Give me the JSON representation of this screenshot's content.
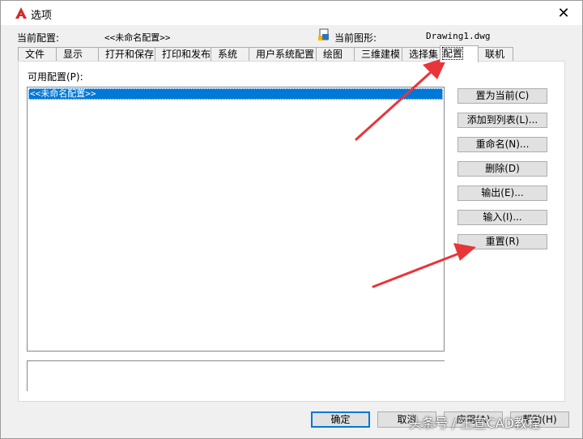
{
  "window": {
    "title": "选项",
    "close_label": "✕"
  },
  "info": {
    "current_profile_label": "当前配置:",
    "current_profile_value": "<<未命名配置>>",
    "current_drawing_label": "当前图形:",
    "current_drawing_value": "Drawing1.dwg"
  },
  "tabs": [
    {
      "label": "文件"
    },
    {
      "label": "显示"
    },
    {
      "label": "打开和保存"
    },
    {
      "label": "打印和发布"
    },
    {
      "label": "系统"
    },
    {
      "label": "用户系统配置"
    },
    {
      "label": "绘图"
    },
    {
      "label": "三维建模"
    },
    {
      "label": "选择集"
    },
    {
      "label": "配置",
      "active": true
    },
    {
      "label": "联机"
    }
  ],
  "profiles": {
    "label": "可用配置(P):",
    "items": [
      "<<未命名配置>>"
    ],
    "selected_index": 0
  },
  "side_buttons": {
    "set_current": "置为当前(C)",
    "add_to_list": "添加到列表(L)...",
    "rename": "重命名(N)...",
    "delete": "删除(D)",
    "export": "输出(E)...",
    "import": "输入(I)...",
    "reset": "重置(R)"
  },
  "bottom_buttons": {
    "ok": "确定",
    "cancel": "取消",
    "apply": "应用(A)",
    "help": "帮助(H)"
  },
  "watermark": "头条号 / 王宣CAD教程",
  "colors": {
    "selection": "#0078d7",
    "annotation_arrow": "#e8353a",
    "autocad_logo": "#d32a2a"
  }
}
